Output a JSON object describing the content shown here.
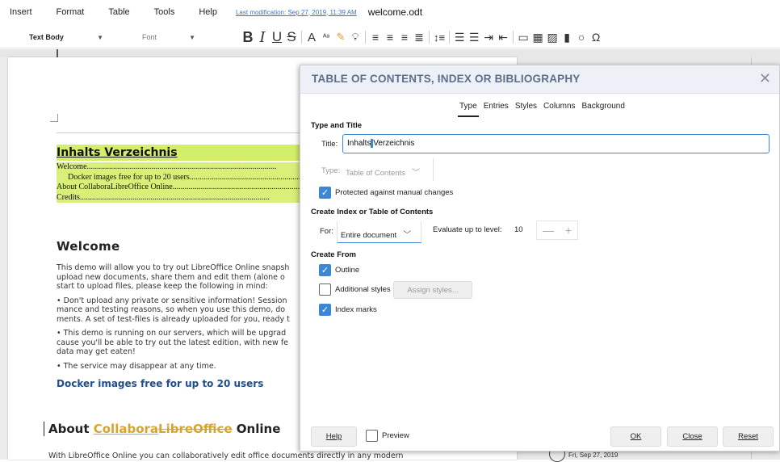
{
  "menubar": {
    "items": [
      "Insert",
      "Format",
      "Table",
      "Tools",
      "Help"
    ],
    "last_modification": "Last modification: Sep 27, 2019, 11:39 AM",
    "document_name": "welcome.odt"
  },
  "toolbar": {
    "paragraph_style": "Text Body",
    "font_name": "Font"
  },
  "document": {
    "toc_title": "Inhalts Verzeichnis",
    "toc_entries": [
      {
        "text": "Welcome",
        "level": 1
      },
      {
        "text": "Docker images free for up to 20 users",
        "level": 2
      },
      {
        "text": "About CollaboraLibreOffice Online",
        "level": 1
      },
      {
        "text": "Credits",
        "level": 1
      }
    ],
    "welcome_heading": "Welcome",
    "welcome_paragraphs": [
      "This demo will allow you to try out LibreOffice Online snapsh",
      "upload new documents, share them and edit them (alone o",
      "start to upload files, please keep the following in mind:"
    ],
    "bullet1": [
      "• Don't upload any private or sensitive information! Session",
      "mance and testing reasons, so when you use this demo, do",
      "ments. A set of test-files is already uploaded for you, ready t"
    ],
    "bullet2": [
      "• This demo is running on our servers, which will be upgrad",
      "cause you'll be able to try out the latest edition, with new fe",
      "data may get eaten!"
    ],
    "bullet3": "• The service may disappear at any time.",
    "docker_heading": "Docker images free for up to 20 users",
    "about_prefix": "About ",
    "about_collabora": "Collabora",
    "about_libreoffice": "LibreOffice",
    "about_suffix": " Online",
    "bottom_line": "With LibreOffice Online you can collaboratively edit office documents directly in any modern",
    "side_date": "Fri, Sep 27, 2019"
  },
  "dialog": {
    "title": "TABLE OF CONTENTS, INDEX OR BIBLIOGRAPHY",
    "tabs": [
      "Type",
      "Entries",
      "Styles",
      "Columns",
      "Background"
    ],
    "active_tab": "Type",
    "type_and_title_heading": "Type and Title",
    "title_label": "Title:",
    "title_value_pre": "Inhalts",
    "title_value_sel": " ",
    "title_value_post": "Verzeichnis",
    "type_label": "Type:",
    "type_value": "Table of Contents",
    "protected_label": "Protected against manual changes",
    "create_index_heading": "Create Index or Table of Contents",
    "for_label": "For:",
    "for_value": "Entire document",
    "evaluate_label": "Evaluate up to level:",
    "level_value": "10",
    "create_from_heading": "Create From",
    "outline_label": "Outline",
    "additional_styles_label": "Additional styles",
    "assign_styles_label": "Assign styles...",
    "index_marks_label": "Index marks",
    "help_label": "Help",
    "preview_label": "Preview",
    "ok_label": "OK",
    "close_label": "Close",
    "reset_label": "Reset"
  }
}
